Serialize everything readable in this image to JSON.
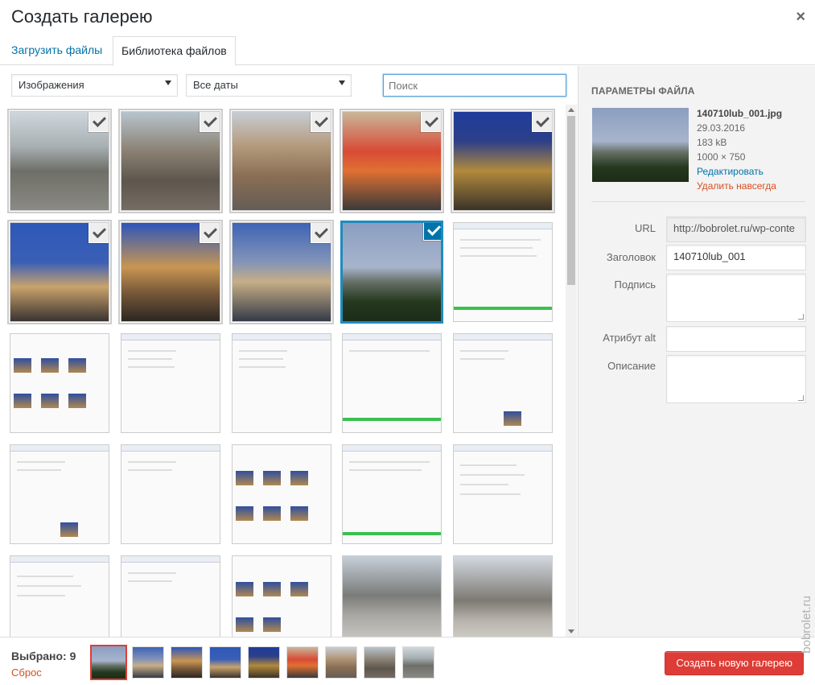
{
  "header": {
    "title": "Создать галерею",
    "close_icon": "close-icon ×"
  },
  "tabs": [
    {
      "label": "Загрузить файлы"
    },
    {
      "label": "Библиотека файлов",
      "active": true
    }
  ],
  "toolbar": {
    "type_filter": "Изображения",
    "date_filter": "Все даты",
    "search_placeholder": "Поиск"
  },
  "grid": {
    "rows": [
      [
        "street-rain",
        "fountain",
        "square",
        "shop",
        "night-street"
      ],
      [
        "night-square",
        "night-tower",
        "night-bridge",
        "castle",
        "screenshot-table"
      ],
      [
        "screenshot-thumbs",
        "screenshot-dialog",
        "screenshot-dialog",
        "screenshot-table-green",
        "screenshot-dialog-thumb"
      ],
      [
        "screenshot-dialog-thumb",
        "screenshot-dialog",
        "screenshot-thumbs2",
        "screenshot-table-green",
        "screenshot-settings"
      ],
      [
        "screenshot-settings2",
        "screenshot-dialog",
        "screenshot-thumbs2",
        "winter-road",
        "winter-square"
      ]
    ],
    "selected_count_in_grid": 9
  },
  "sidebar": {
    "heading": "Параметры файла",
    "filename": "140710lub_001.jpg",
    "date": "29.03.2016",
    "size": "183 kB",
    "dimensions": "1000 × 750",
    "edit_link": "Редактировать",
    "delete_link": "Удалить навсегда",
    "fields": {
      "url_label": "URL",
      "url_value": "http://bobrolet.ru/wp-conte",
      "title_label": "Заголовок",
      "title_value": "140710lub_001",
      "caption_label": "Подпись",
      "alt_label": "Атрибут alt",
      "description_label": "Описание"
    }
  },
  "footer": {
    "selected_label": "Выбрано: 9",
    "reset_link": "Сброс",
    "create_button": "Создать новую галерею"
  },
  "watermark": "bobrolet.ru",
  "colors": {
    "accent": "#0073aa",
    "danger": "#dd3d36",
    "selected_border": "#1e8cbe"
  }
}
